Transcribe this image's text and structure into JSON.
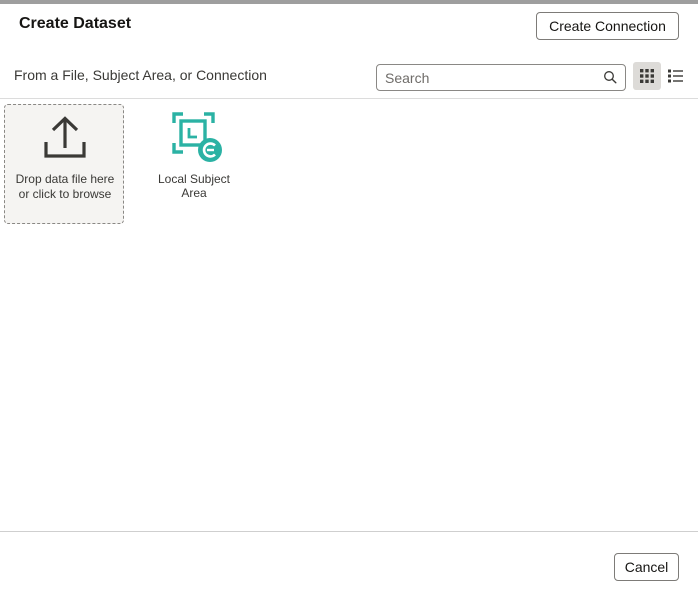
{
  "dialog": {
    "title": "Create Dataset",
    "create_connection_label": "Create Connection",
    "subtitle": "From a File, Subject Area, or Connection",
    "search": {
      "placeholder": "Search",
      "value": ""
    },
    "view_modes": {
      "grid": "grid-view-icon",
      "list": "list-view-icon",
      "selected": "grid"
    },
    "sources": [
      {
        "label": "Drop data file here or click to browse",
        "icon": "upload-icon"
      },
      {
        "label": "Local Subject Area",
        "icon": "subject-area-icon"
      }
    ],
    "cancel_label": "Cancel"
  },
  "colors": {
    "accent_teal": "#2bb2a4",
    "top_strip": "#9e9e9e",
    "selected_toggle": "#dddbd8"
  }
}
